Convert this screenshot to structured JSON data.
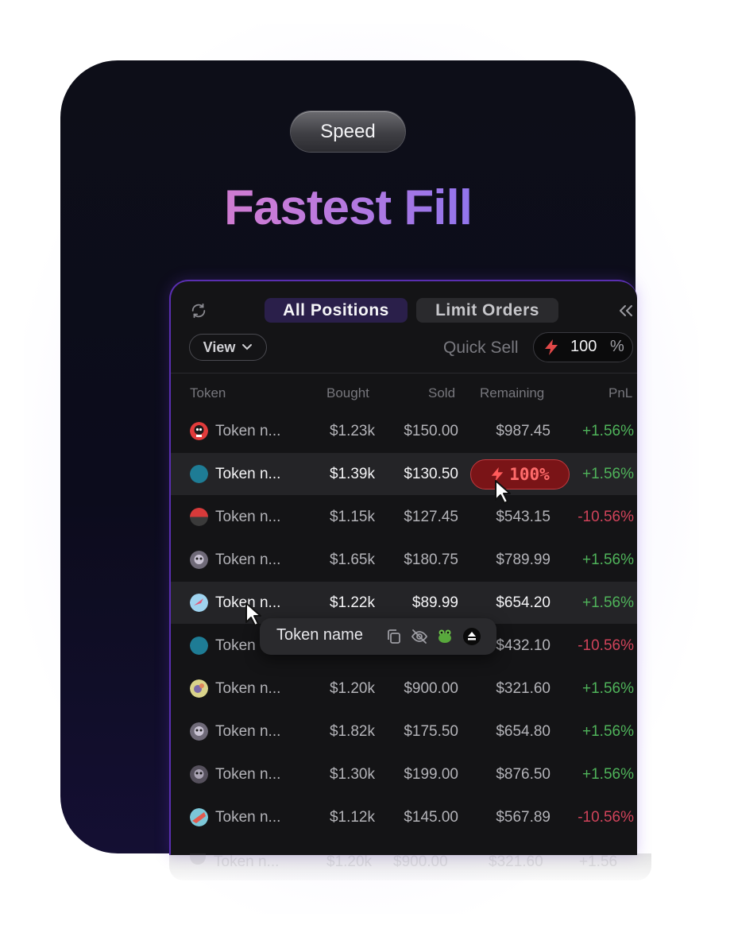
{
  "badge": "Speed",
  "headline": "Fastest Fill",
  "tabs": {
    "all": "All Positions",
    "limit": "Limit Orders"
  },
  "view_label": "View",
  "quick_sell": {
    "label": "Quick Sell",
    "value": "100",
    "unit": "%"
  },
  "columns": {
    "token": "Token",
    "bought": "Bought",
    "sold": "Sold",
    "remaining": "Remaining",
    "pnl": "PnL"
  },
  "rows": [
    {
      "name": "Token n...",
      "bought": "$1.23k",
      "sold": "$150.00",
      "remaining": "$987.45",
      "pnl": "+1.56%"
    },
    {
      "name": "Token n...",
      "bought": "$1.39k",
      "sold": "$130.50",
      "remaining": "",
      "pnl": "+1.56%"
    },
    {
      "name": "Token n...",
      "bought": "$1.15k",
      "sold": "$127.45",
      "remaining": "$543.15",
      "pnl": "-10.56%"
    },
    {
      "name": "Token n...",
      "bought": "$1.65k",
      "sold": "$180.75",
      "remaining": "$789.99",
      "pnl": "+1.56%"
    },
    {
      "name": "Token n...",
      "bought": "$1.22k",
      "sold": "$89.99",
      "remaining": "$654.20",
      "pnl": "+1.56%"
    },
    {
      "name": "Token",
      "bought": "",
      "sold": "",
      "remaining": "$432.10",
      "pnl": "-10.56%"
    },
    {
      "name": "Token n...",
      "bought": "$1.20k",
      "sold": "$900.00",
      "remaining": "$321.60",
      "pnl": "+1.56%"
    },
    {
      "name": "Token n...",
      "bought": "$1.82k",
      "sold": "$175.50",
      "remaining": "$654.80",
      "pnl": "+1.56%"
    },
    {
      "name": "Token n...",
      "bought": "$1.30k",
      "sold": "$199.00",
      "remaining": "$876.50",
      "pnl": "+1.56%"
    },
    {
      "name": "Token n...",
      "bought": "$1.12k",
      "sold": "$145.00",
      "remaining": "$567.89",
      "pnl": "-10.56%"
    }
  ],
  "ghost_row": {
    "name": "Token n...",
    "bought": "$1.20k",
    "sold": "$900.00",
    "remaining": "$321.60",
    "pnl": "+1.56"
  },
  "sell_button": "100%",
  "tooltip": {
    "name": "Token name"
  },
  "colors": {
    "positive": "#4fb35a",
    "negative": "#d0435a",
    "accent": "#5a2fb0",
    "sell": "#7a1417"
  },
  "icons": [
    "refresh-icon",
    "collapse-icon",
    "chevron-down-icon",
    "bolt-icon",
    "cursor-icon",
    "copy-icon",
    "hide-icon",
    "frog-icon",
    "eject-icon"
  ]
}
